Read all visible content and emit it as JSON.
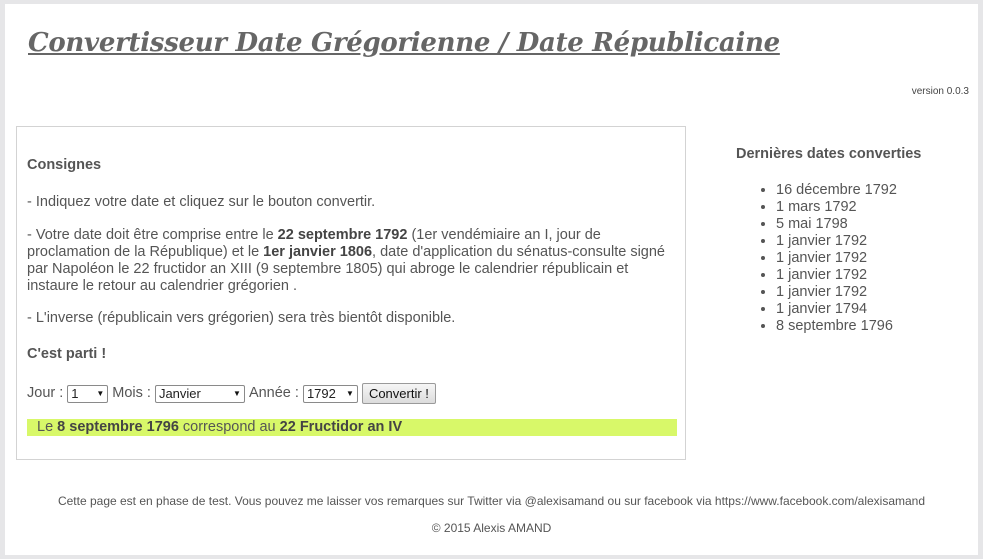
{
  "header": {
    "title": "Convertisseur Date Grégorienne / Date Républicaine",
    "version": "version 0.0.3"
  },
  "main": {
    "consignes_title": "Consignes",
    "line1": "- Indiquez votre date et cliquez sur le bouton convertir.",
    "line2_a": "- Votre date doit être comprise entre le ",
    "line2_b1": "22 septembre 1792",
    "line2_c": " (1er vendémiaire an I, jour de proclamation de la République) et le ",
    "line2_b2": "1er janvier 1806",
    "line2_d": ", date d'application du sénatus-consulte signé par Napoléon le 22 fructidor an XIII (9 septembre 1805) qui abroge le calendrier républicain et instaure le retour au calendrier grégorien .",
    "line3": "- L'inverse (républicain vers grégorien) sera très bientôt disponible.",
    "start_title": "C'est parti !",
    "form": {
      "jour_label": "Jour :",
      "jour_value": "1",
      "mois_label": "Mois :",
      "mois_value": "Janvier",
      "annee_label": "Année :",
      "annee_value": "1792",
      "convert_label": "Convertir !"
    },
    "result": {
      "prefix": "Le ",
      "greg": "8 septembre 1796",
      "mid": " correspond au ",
      "rep": "22 Fructidor an IV",
      "highlight_color": "#d8f869"
    }
  },
  "sidebar": {
    "title": "Dernières dates converties",
    "items": [
      "16 décembre 1792",
      "1 mars 1792",
      "5 mai 1798",
      "1 janvier 1792",
      "1 janvier 1792",
      "1 janvier 1792",
      "1 janvier 1792",
      "1 janvier 1794",
      "8 septembre 1796"
    ]
  },
  "footer": {
    "note": "Cette page est en phase de test. Vous pouvez me laisser vos remarques sur Twitter via @alexisamand ou sur facebook via https://www.facebook.com/alexisamand",
    "copyright": "© 2015 Alexis AMAND"
  }
}
